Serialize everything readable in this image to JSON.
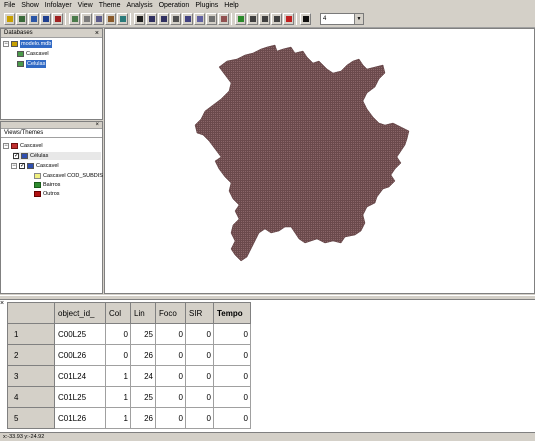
{
  "menu": [
    "File",
    "Show",
    "Infolayer",
    "View",
    "Theme",
    "Analysis",
    "Operation",
    "Plugins",
    "Help"
  ],
  "toolbar": {
    "zoom_value": "4",
    "icons": [
      "open-icon",
      "save-icon",
      "database-icon",
      "view-icon",
      "theme-icon",
      "layer-icon",
      "table-icon",
      "pointer-icon",
      "zoom-in-icon",
      "zoom-out-icon",
      "pan-icon",
      "fit-icon",
      "grid-icon",
      "draw-icon",
      "back-icon",
      "forward-icon",
      "up-icon",
      "select-icon",
      "delete-icon"
    ]
  },
  "databases": {
    "title": "Databases",
    "root": "modelo.mdb",
    "items": [
      "Cascavel",
      "Celulas"
    ]
  },
  "views": {
    "title": "Views/Themes",
    "view": "Cascavel",
    "themes": [
      "Células",
      "Cascavel"
    ],
    "legend": [
      "Cascavel COD_SUBDIS",
      "Bairros",
      "Outros"
    ]
  },
  "colors": {
    "map_fill": "#6b4a4c",
    "legend_yellow": "#f0f080",
    "legend_green": "#2e8b2e",
    "legend_red": "#b01010"
  },
  "grid": {
    "columns": [
      "object_id_",
      "Col",
      "Lin",
      "Foco",
      "SIR",
      "Tempo"
    ],
    "rows": [
      {
        "num": "1",
        "object_id_": "C00L25",
        "Col": "0",
        "Lin": "25",
        "Foco": "0",
        "SIR": "0",
        "Tempo": "0"
      },
      {
        "num": "2",
        "object_id_": "C00L26",
        "Col": "0",
        "Lin": "26",
        "Foco": "0",
        "SIR": "0",
        "Tempo": "0"
      },
      {
        "num": "3",
        "object_id_": "C01L24",
        "Col": "1",
        "Lin": "24",
        "Foco": "0",
        "SIR": "0",
        "Tempo": "0"
      },
      {
        "num": "4",
        "object_id_": "C01L25",
        "Col": "1",
        "Lin": "25",
        "Foco": "0",
        "SIR": "0",
        "Tempo": "0"
      },
      {
        "num": "5",
        "object_id_": "C01L26",
        "Col": "1",
        "Lin": "26",
        "Foco": "0",
        "SIR": "0",
        "Tempo": "0"
      }
    ]
  },
  "status": "x:-33.93 y:-24.92"
}
